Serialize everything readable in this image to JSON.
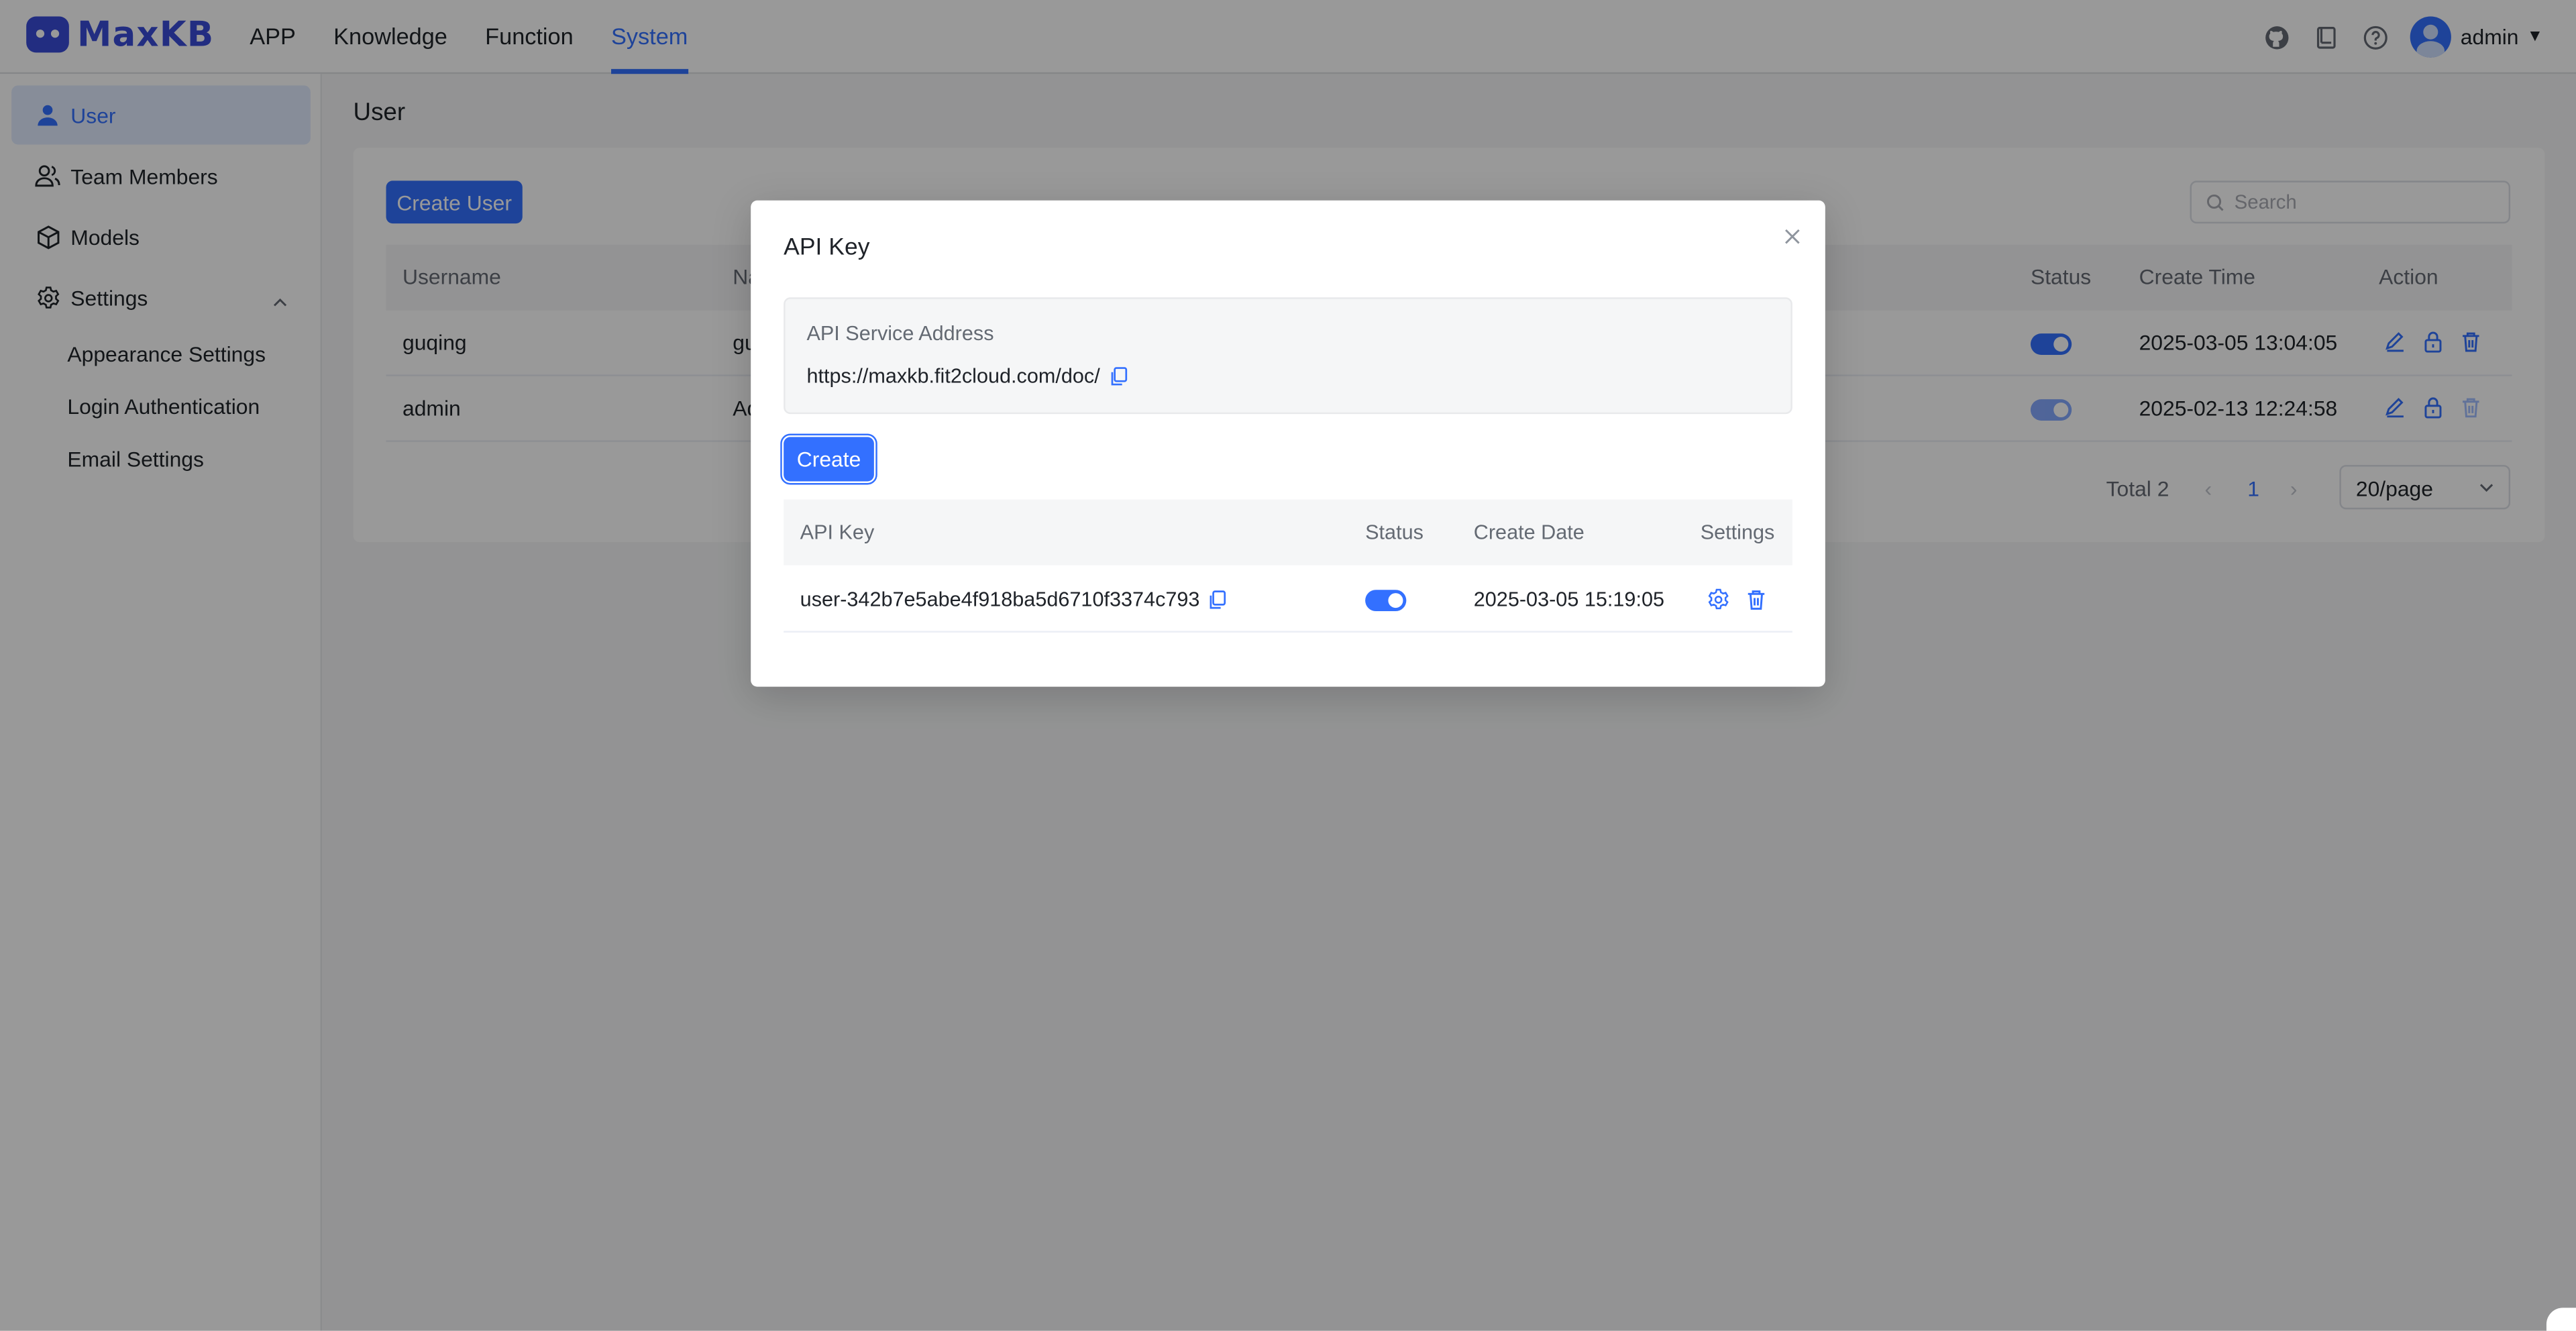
{
  "app": {
    "logo_text": "MaxKB",
    "brand_color": "#3a4bd8",
    "accent_color": "#3370ff"
  },
  "topnav": {
    "items": [
      {
        "label": "APP",
        "active": false
      },
      {
        "label": "Knowledge",
        "active": false
      },
      {
        "label": "Function",
        "active": false
      },
      {
        "label": "System",
        "active": true
      }
    ],
    "icons": [
      "github-icon",
      "document-icon",
      "help-icon"
    ],
    "user": "admin"
  },
  "sidebar": {
    "items": [
      {
        "label": "User",
        "icon": "user-icon",
        "active": true
      },
      {
        "label": "Team Members",
        "icon": "team-icon",
        "active": false
      },
      {
        "label": "Models",
        "icon": "cube-icon",
        "active": false
      },
      {
        "label": "Settings",
        "icon": "gear-icon",
        "active": false,
        "expanded": true
      }
    ],
    "sub_items": [
      "Appearance Settings",
      "Login Authentication",
      "Email Settings"
    ]
  },
  "page": {
    "title": "User",
    "create_button": "Create User",
    "search_placeholder": "Search",
    "columns": [
      "Username",
      "Na",
      "Status",
      "Create Time",
      "Action"
    ],
    "rows": [
      {
        "username": "guqing",
        "name": "gu",
        "status": true,
        "create_time": "2025-03-05 13:04:05"
      },
      {
        "username": "admin",
        "name": "Ad",
        "status": true,
        "create_time": "2025-02-13 12:24:58"
      }
    ],
    "pagination": {
      "total": "Total 2",
      "current": "1",
      "page_size": "20/page"
    }
  },
  "dialog": {
    "title": "API Key",
    "address_label": "API Service Address",
    "address_url": "https://maxkb.fit2cloud.com/doc/",
    "create_button": "Create",
    "columns": [
      "API Key",
      "Status",
      "Create Date",
      "Settings"
    ],
    "rows": [
      {
        "key": "user-342b7e5abe4f918ba5d6710f3374c793",
        "status": true,
        "create_date": "2025-03-05 15:19:05"
      }
    ]
  }
}
